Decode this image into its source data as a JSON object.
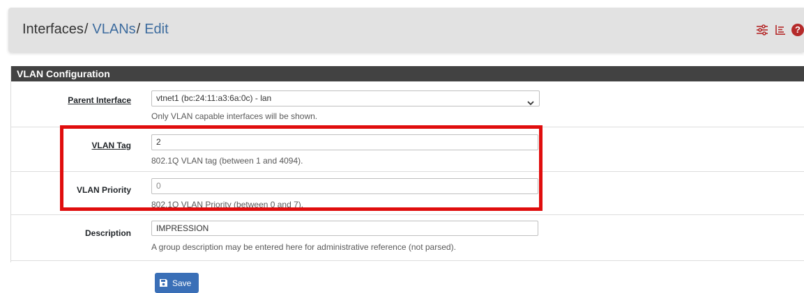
{
  "breadcrumb": {
    "part1": "Interfaces",
    "part2": "VLANs",
    "part3": "Edit",
    "separator": "/"
  },
  "header_icons": [
    "sliders-icon",
    "list-icon",
    "help-icon"
  ],
  "help_icon_glyph": "?",
  "panel": {
    "title": "VLAN Configuration",
    "fields": {
      "parent_interface": {
        "label": "Parent Interface",
        "value": "vtnet1 (bc:24:11:a3:6a:0c) - lan",
        "help": "Only VLAN capable interfaces will be shown."
      },
      "vlan_tag": {
        "label": "VLAN Tag",
        "value": "2",
        "help": "802.1Q VLAN tag (between 1 and 4094)."
      },
      "vlan_priority": {
        "label": "VLAN Priority",
        "value": "0",
        "help": "802.1Q VLAN Priority (between 0 and 7)."
      },
      "description": {
        "label": "Description",
        "value": "IMPRESSION",
        "help": "A group description may be entered here for administrative reference (not parsed)."
      }
    }
  },
  "save_button": {
    "label": "Save"
  },
  "colors": {
    "accent": "#3a6fb7",
    "link": "#3c6b9e",
    "panel_heading": "#424242",
    "highlight": "#e00d0d",
    "help_icon": "#b52a2a"
  }
}
